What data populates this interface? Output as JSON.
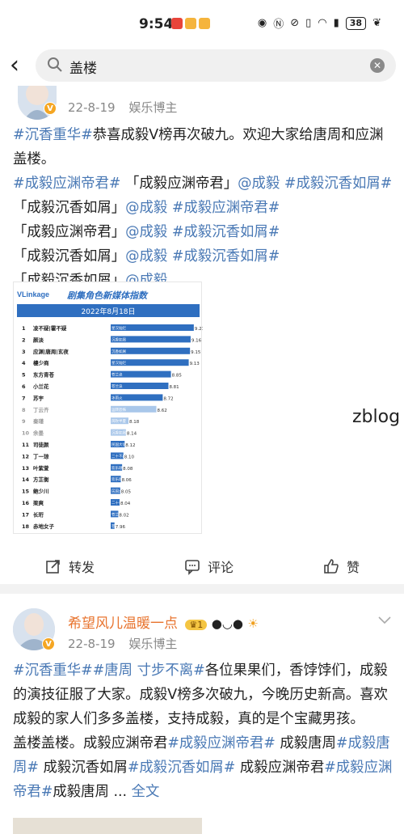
{
  "status": {
    "time": "9:54",
    "battery": "38"
  },
  "search": {
    "query": "盖楼"
  },
  "post1": {
    "date": "22-8-19",
    "source": "娱乐博主",
    "segments": [
      {
        "t": "#沉香重华#",
        "h": true
      },
      {
        "t": "恭喜成毅V榜再次破九。欢迎大家给唐周和应渊盖楼。",
        "h": false
      },
      {
        "t": "\n",
        "h": false
      },
      {
        "t": "#成毅应渊帝君#",
        "h": true
      },
      {
        "t": " 「成毅应渊帝君」",
        "h": false
      },
      {
        "t": "@成毅",
        "h": true
      },
      {
        "t": " ",
        "h": false
      },
      {
        "t": "#成毅沉香如屑#",
        "h": true
      },
      {
        "t": " 「成毅沉香如屑」",
        "h": false
      },
      {
        "t": "@成毅",
        "h": true
      },
      {
        "t": " ",
        "h": false
      },
      {
        "t": "#成毅应渊帝君#",
        "h": true
      },
      {
        "t": " 「成毅应渊帝君」",
        "h": false
      },
      {
        "t": "@成毅",
        "h": true
      },
      {
        "t": " ",
        "h": false
      },
      {
        "t": "#成毅沉香如屑#",
        "h": true
      },
      {
        "t": " 「成毅沉香如屑」",
        "h": false
      },
      {
        "t": "@成毅",
        "h": true
      },
      {
        "t": " ",
        "h": false
      },
      {
        "t": "#成毅沉香如屑#",
        "h": true
      },
      {
        "t": " 「成毅沉香如屑」",
        "h": false
      },
      {
        "t": "@成毅",
        "h": true
      }
    ],
    "actions": {
      "repost": "转发",
      "comment": "评论",
      "like": "赞"
    }
  },
  "chart_data": {
    "type": "bar",
    "logo": "VLinkage",
    "title": "剧集角色新媒体指数",
    "date": "2022年8月18日",
    "ranks": [
      "1",
      "2",
      "3",
      "4",
      "5",
      "6",
      "7",
      "8",
      "9",
      "10",
      "11",
      "12",
      "13",
      "14",
      "15",
      "16",
      "17",
      "18"
    ],
    "categories": [
      "凌不疑|霍不疑",
      "颜淡",
      "应渊|唐周|玄夜",
      "樓少商",
      "东方青苍",
      "小兰花",
      "苏宇",
      "丁云齐",
      "秦瑾",
      "余墨",
      "司徒颜",
      "丁一琼",
      "叶紫萱",
      "方芷衡",
      "鲍少川",
      "梁爽",
      "长珩",
      "赤地女子"
    ],
    "dramas": [
      "星汉灿烂",
      "沉香如屑",
      "沉香如屑",
      "星汉灿烂",
      "苍兰诀",
      "苍兰诀",
      "冰雨火",
      "运转恐怖",
      "风吹半夏",
      "沉香如屑",
      "民国大侦探",
      "二十不惑2",
      "欢乐颂3",
      "欢乐颂3",
      "民国大侦探",
      "二十不惑2",
      "苍兰诀",
      "苍兰诀"
    ],
    "values": [
      9.21,
      9.16,
      9.15,
      9.13,
      8.85,
      8.81,
      8.72,
      8.62,
      8.18,
      8.14,
      8.12,
      8.1,
      8.08,
      8.06,
      8.05,
      8.04,
      8.02,
      7.96
    ],
    "value_labels": [
      "9.21",
      "9.16",
      "9.15",
      "9.13",
      "8.85",
      "8.81",
      "8.72",
      "8.62",
      "8.18",
      "8.14",
      "8.12",
      "8.10",
      "8.08",
      "8.06",
      "8.05",
      "8.04",
      "8.02",
      "7.96"
    ],
    "colors": {
      "bar": "#2f6fc0",
      "bar_faded": "#a9c7ea",
      "header": "#2f6fc0"
    }
  },
  "watermark": "zblog",
  "post2": {
    "username": "希望风儿温暖一点",
    "level": "1",
    "date": "22-8-19",
    "source": "娱乐博主",
    "segments": [
      {
        "t": "#沉香重华##唐周 寸步不离#",
        "h": true
      },
      {
        "t": "各位果果们，香饽饽们，成毅的演技征服了大家。成毅V榜多次破九，今晚历史新高。喜欢成毅的家人们多多盖楼，支持成毅，真的是个宝藏男孩。",
        "h": false
      },
      {
        "t": "\n",
        "h": false
      },
      {
        "t": " 盖楼盖楼。成毅应渊帝君",
        "h": false
      },
      {
        "t": "#成毅应渊帝君#",
        "h": true
      },
      {
        "t": " 成毅唐周",
        "h": false
      },
      {
        "t": "#成毅唐周#",
        "h": true
      },
      {
        "t": " 成毅沉香如屑",
        "h": false
      },
      {
        "t": "#成毅沉香如屑#",
        "h": true
      },
      {
        "t": " 成毅应渊帝君",
        "h": false
      },
      {
        "t": "#成毅应渊帝君#",
        "h": true
      },
      {
        "t": "成毅唐周 ... ",
        "h": false
      },
      {
        "t": "全文",
        "h": true
      }
    ]
  }
}
